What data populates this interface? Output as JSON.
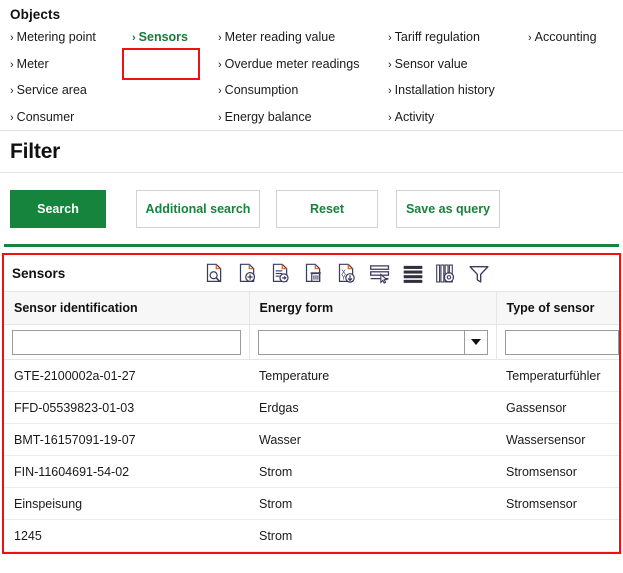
{
  "objects": {
    "title": "Objects",
    "columns": [
      {
        "items": [
          {
            "label": "Metering point",
            "active": false
          },
          {
            "label": "Meter",
            "active": false
          },
          {
            "label": "Service area",
            "active": false
          },
          {
            "label": "Consumer",
            "active": false
          }
        ]
      },
      {
        "items": [
          {
            "label": "Sensors",
            "active": true
          }
        ]
      },
      {
        "items": [
          {
            "label": "Meter reading value",
            "active": false
          },
          {
            "label": "Overdue meter readings",
            "active": false
          },
          {
            "label": "Consumption",
            "active": false
          },
          {
            "label": "Energy balance",
            "active": false
          }
        ]
      },
      {
        "items": [
          {
            "label": "Tariff regulation",
            "active": false
          },
          {
            "label": "Sensor value",
            "active": false
          },
          {
            "label": "Installation history",
            "active": false
          },
          {
            "label": "Activity",
            "active": false
          }
        ]
      },
      {
        "items": [
          {
            "label": "Accounting",
            "active": false
          }
        ]
      }
    ],
    "chevron": "›",
    "highlight_color": "#ee1111",
    "active_color": "#177b3b"
  },
  "filter": {
    "title": "Filter",
    "buttons": {
      "search": "Search",
      "additional_search": "Additional search",
      "reset": "Reset",
      "save_as_query": "Save as query"
    },
    "accent_color": "#16843c"
  },
  "results": {
    "title": "Sensors",
    "outline_color": "#ee1111",
    "toolbar": [
      {
        "name": "document-search-icon",
        "tooltip": "Display"
      },
      {
        "name": "document-add-icon",
        "tooltip": "New"
      },
      {
        "name": "document-edit-icon",
        "tooltip": "Edit"
      },
      {
        "name": "document-delete-icon",
        "tooltip": "Delete"
      },
      {
        "name": "document-download-icon",
        "tooltip": "Export"
      },
      {
        "name": "select-rows-icon",
        "tooltip": "Select"
      },
      {
        "name": "list-view-icon",
        "tooltip": "List view"
      },
      {
        "name": "column-settings-icon",
        "tooltip": "Column settings"
      },
      {
        "name": "filter-funnel-icon",
        "tooltip": "Filter"
      }
    ],
    "columns": [
      {
        "header": "Sensor identification",
        "filter_type": "text",
        "filter_value": "",
        "filter_placeholder": ""
      },
      {
        "header": "Energy form",
        "filter_type": "combo",
        "filter_value": "",
        "filter_placeholder": ""
      },
      {
        "header": "Type of sensor",
        "filter_type": "text",
        "filter_value": "",
        "filter_placeholder": ""
      }
    ],
    "rows": [
      {
        "sensor_identification": "GTE-2100002a-01-27",
        "energy_form": "Temperature",
        "type_of_sensor": "Temperaturfühler"
      },
      {
        "sensor_identification": "FFD-05539823-01-03",
        "energy_form": "Erdgas",
        "type_of_sensor": "Gassensor"
      },
      {
        "sensor_identification": "BMT-16157091-19-07",
        "energy_form": "Wasser",
        "type_of_sensor": "Wassersensor"
      },
      {
        "sensor_identification": "FIN-11604691-54-02",
        "energy_form": "Strom",
        "type_of_sensor": "Stromsensor"
      },
      {
        "sensor_identification": "Einspeisung",
        "energy_form": "Strom",
        "type_of_sensor": "Stromsensor"
      },
      {
        "sensor_identification": "1245",
        "energy_form": "Strom",
        "type_of_sensor": ""
      }
    ]
  }
}
